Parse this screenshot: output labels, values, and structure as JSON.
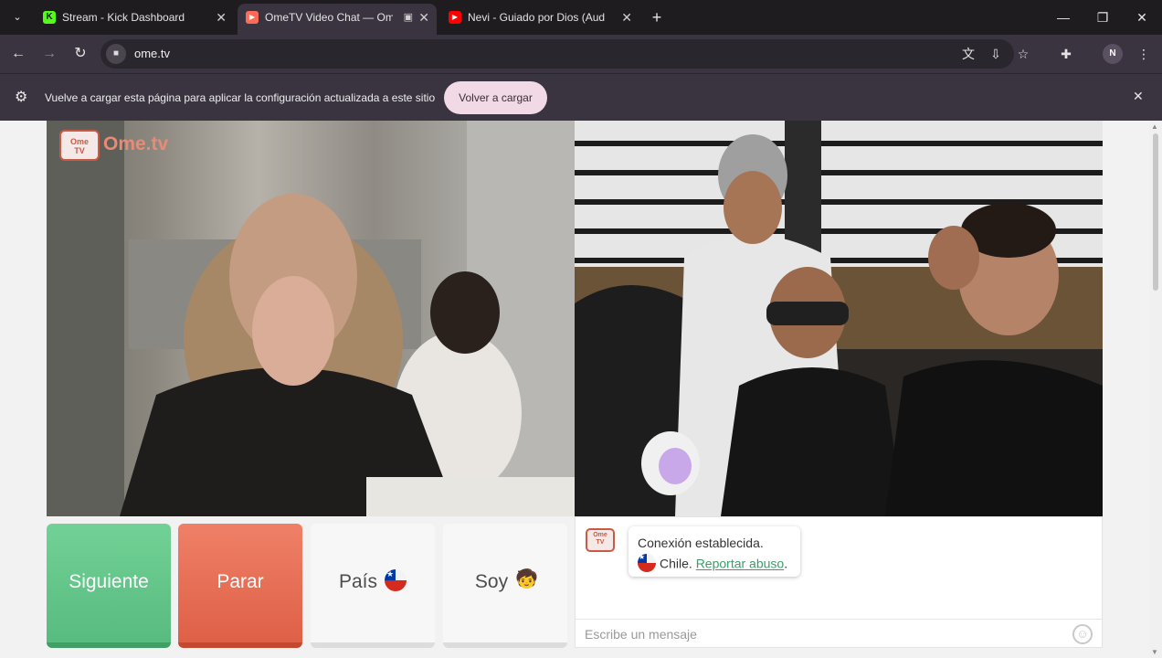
{
  "browser": {
    "tabs": [
      {
        "label": "Stream - Kick Dashboard",
        "favicon": "K",
        "favicon_color": "#53fc18",
        "active": false
      },
      {
        "label": "OmeTV Video Chat — Ome",
        "favicon": "▶",
        "favicon_color": "#ff6b57",
        "active": true
      },
      {
        "label": "Nevi - Guiado por Dios (Audio",
        "favicon": "▶",
        "favicon_color": "#ff0000",
        "active": false
      }
    ],
    "url": "ome.tv",
    "profile_initial": "N",
    "icons": [
      "translate-icon",
      "install-icon",
      "bookmark-star-icon",
      "extensions-icon",
      "menu-icon"
    ]
  },
  "infobar": {
    "message": "Vuelve a cargar esta página para aplicar la configuración actualizada a este sitio",
    "button_label": "Volver a cargar"
  },
  "app": {
    "logo_text": "Ome.tv",
    "logo_badge": "Ome TV",
    "buttons": {
      "next": "Siguiente",
      "stop": "Parar",
      "country": "País",
      "gender": "Soy"
    },
    "chat": {
      "status": "Conexión establecida.",
      "country": "Chile.",
      "report_link": "Reportar abuso",
      "trailing": ".",
      "input_placeholder": "Escribe un mensaje"
    }
  },
  "colors": {
    "next_button": "#5ec486",
    "stop_button": "#e66a50",
    "link": "#3b9c6b",
    "browser_chrome": "#3a3440"
  }
}
